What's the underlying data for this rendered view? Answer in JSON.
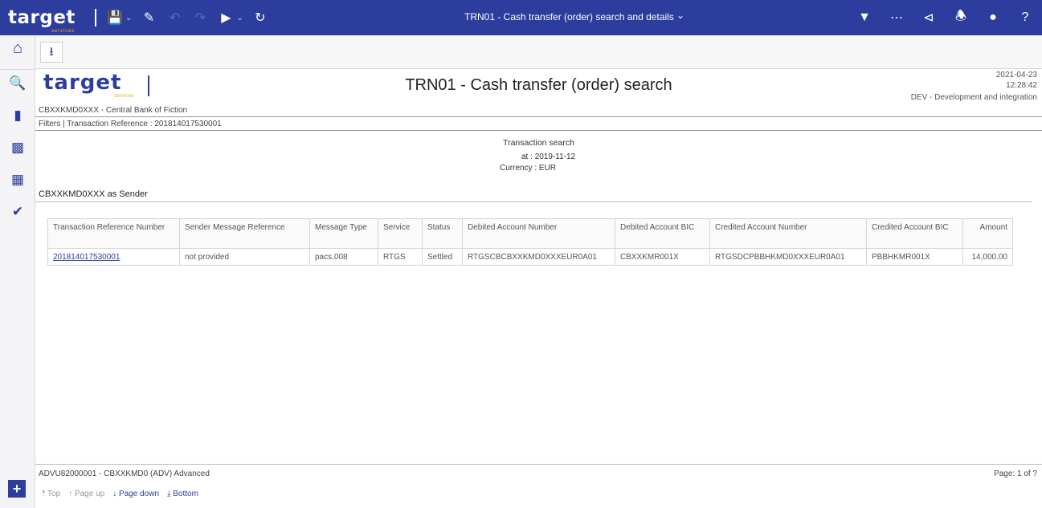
{
  "app": {
    "brand": "target",
    "brand_sub": "services",
    "window_title": "TRN01 - Cash transfer (order) search and details"
  },
  "toolbar": {
    "left_icons": [
      "save-icon",
      "pencil-icon",
      "undo-icon",
      "redo-icon",
      "play-icon",
      "refresh-icon"
    ],
    "right_icons": [
      "filter-icon",
      "more-icon",
      "share-icon",
      "bell-icon",
      "user-icon",
      "help-icon"
    ]
  },
  "page": {
    "title": "TRN01 - Cash transfer (order) search",
    "date": "2021-04-23",
    "time": "12:28:42",
    "environment": "DEV - Development and integration",
    "bank": "CBXXKMD0XXX - Central Bank of Fiction",
    "filters": "Filters | Transaction Reference : 201814017530001"
  },
  "search": {
    "title": "Transaction search",
    "at_label": "at :",
    "at_value": "2019-11-12",
    "currency_label": "Currency :",
    "currency_value": "EUR",
    "sender_heading": "CBXXKMD0XXX as Sender"
  },
  "table": {
    "headers": [
      "Transaction Reference Number",
      "Sender Message Reference",
      "Message Type",
      "Service",
      "Status",
      "Debited Account Number",
      "Debited Account BIC",
      "Credited Account Number",
      "Credited Account BIC",
      "Amount"
    ],
    "rows": [
      {
        "trn": "201814017530001",
        "sender_ref": "not provided",
        "msg_type": "pacs.008",
        "service": "RTGS",
        "status": "Settled",
        "debited_acct": "RTGSCBCBXXKMD0XXXEUR0A01",
        "debited_bic": "CBXXKMR001X",
        "credited_acct": "RTGSDCPBBHKMD0XXXEUR0A01",
        "credited_bic": "PBBHKMR001X",
        "amount": "14,000.00"
      }
    ]
  },
  "footer": {
    "user": "ADVU82000001 - CBXXKMD0 (ADV) Advanced",
    "page": "Page: 1 of ?",
    "pager": {
      "top": "Top",
      "page_up": "Page up",
      "page_down": "Page down",
      "bottom": "Bottom"
    }
  }
}
